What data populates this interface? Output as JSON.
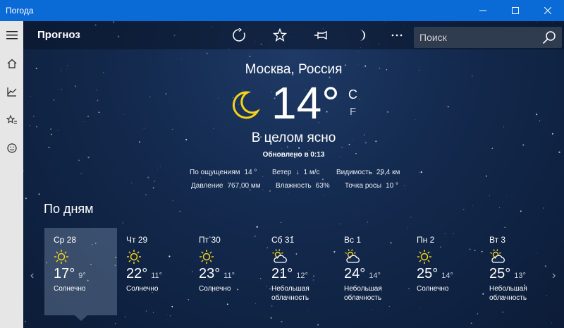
{
  "window": {
    "title": "Погода"
  },
  "toolbar": {
    "page_label": "Прогноз",
    "search_placeholder": "Поиск"
  },
  "current": {
    "location": "Москва, Россия",
    "temperature": "14",
    "degree": "°",
    "unit_c": "C",
    "unit_f": "F",
    "condition": "В целом ясно",
    "updated": "Обновлено в 0:13",
    "feels_like_label": "По ощущениям",
    "feels_like_value": "14 °",
    "wind_label": "Ветер",
    "wind_value": "1 м/с",
    "visibility_label": "Видимость",
    "visibility_value": "29,4 км",
    "pressure_label": "Давление",
    "pressure_value": "767,00 мм",
    "humidity_label": "Влажность",
    "humidity_value": "63%",
    "dewpoint_label": "Точка росы",
    "dewpoint_value": "10 °"
  },
  "daily": {
    "title": "По дням",
    "days": [
      {
        "name": "Ср 28",
        "icon": "sun-icon",
        "hi": "17°",
        "lo": "9°",
        "desc": "Солнечно"
      },
      {
        "name": "Чт 29",
        "icon": "sun-icon",
        "hi": "22°",
        "lo": "11°",
        "desc": "Солнечно"
      },
      {
        "name": "Пт 30",
        "icon": "sun-icon",
        "hi": "23°",
        "lo": "11°",
        "desc": "Солнечно"
      },
      {
        "name": "Сб 31",
        "icon": "partly-cloudy-icon",
        "hi": "21°",
        "lo": "12°",
        "desc": "Небольшая облачность"
      },
      {
        "name": "Вс 1",
        "icon": "partly-cloudy-icon",
        "hi": "24°",
        "lo": "14°",
        "desc": "Небольшая облачность"
      },
      {
        "name": "Пн 2",
        "icon": "sun-icon",
        "hi": "25°",
        "lo": "14°",
        "desc": "Солнечно"
      },
      {
        "name": "Вт 3",
        "icon": "partly-cloudy-icon",
        "hi": "25°",
        "lo": "13°",
        "desc": "Небольшая облачность"
      }
    ]
  },
  "colors": {
    "titlebar": "#0a6ad6",
    "rail": "#e6e6e6",
    "sun": "#f5d21b"
  }
}
